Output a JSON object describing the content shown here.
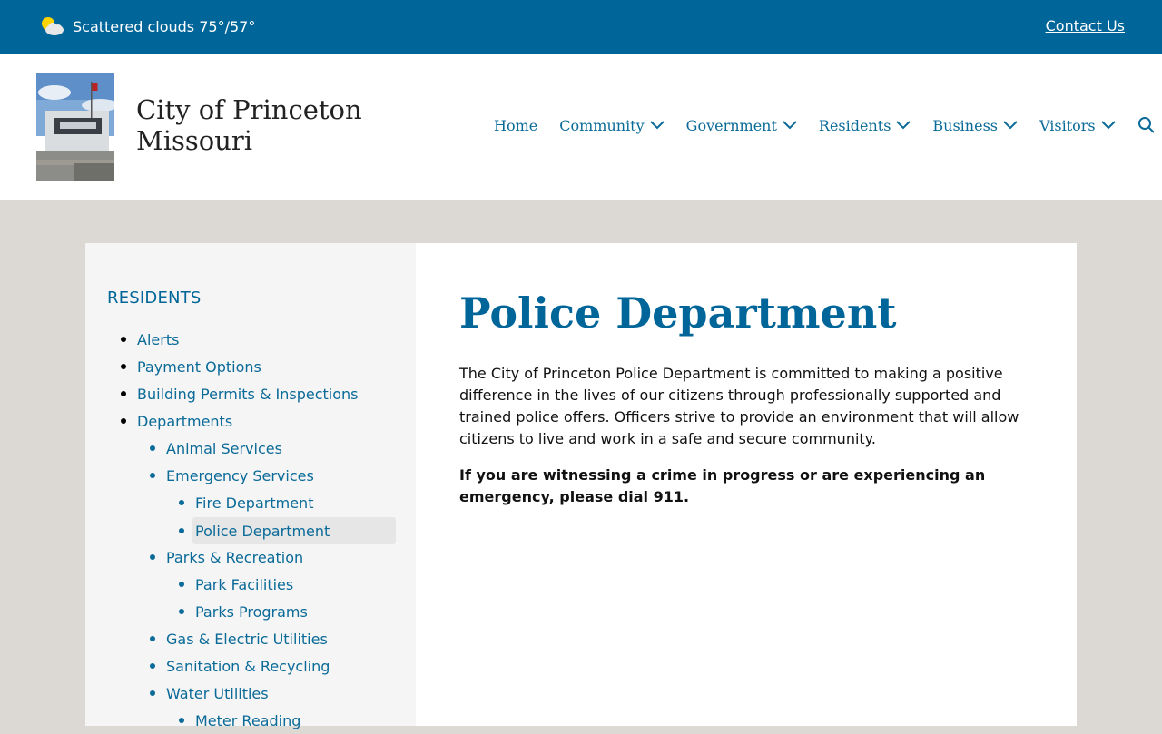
{
  "topbar": {
    "weather_text": "Scattered clouds 75°/57°",
    "contact_label": "Contact Us"
  },
  "header": {
    "title_line1": "City of Princeton",
    "title_line2": "Missouri",
    "nav": [
      {
        "label": "Home",
        "has_dropdown": false
      },
      {
        "label": "Community",
        "has_dropdown": true
      },
      {
        "label": "Government",
        "has_dropdown": true
      },
      {
        "label": "Residents",
        "has_dropdown": true
      },
      {
        "label": "Business",
        "has_dropdown": true
      },
      {
        "label": "Visitors",
        "has_dropdown": true
      }
    ],
    "search_icon": "search-icon"
  },
  "sidebar": {
    "heading": "RESIDENTS",
    "items": [
      {
        "label": "Alerts"
      },
      {
        "label": "Payment Options"
      },
      {
        "label": "Building Permits & Inspections"
      },
      {
        "label": "Departments"
      },
      {
        "label": "Animal Services"
      },
      {
        "label": "Emergency Services"
      },
      {
        "label": "Fire Department"
      },
      {
        "label": "Police Department",
        "active": true
      },
      {
        "label": "Parks & Recreation"
      },
      {
        "label": "Park Facilities"
      },
      {
        "label": "Parks Programs"
      },
      {
        "label": "Gas & Electric Utilities"
      },
      {
        "label": "Sanitation & Recycling"
      },
      {
        "label": "Water Utilities"
      },
      {
        "label": "Meter Reading"
      }
    ]
  },
  "main": {
    "title": "Police Department",
    "paragraph1": "The City of Princeton Police Department is committed to making a positive difference in the lives of our citizens through professionally supported and trained police offers. Officers strive to provide an environment that will allow citizens to live and work in a safe and secure community.",
    "paragraph2": "If you are witnessing a crime in progress or are experiencing an emergency, please dial 911."
  },
  "colors": {
    "topbar_bg": "#006699",
    "link": "#0a6a98",
    "page_bg": "#dcd8d4",
    "sidebar_bg": "#f5f5f5"
  }
}
